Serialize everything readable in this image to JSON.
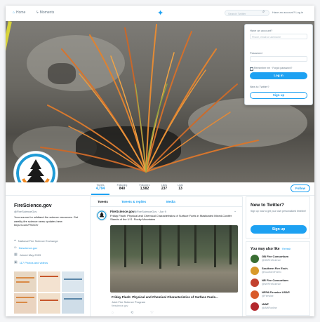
{
  "nav": {
    "home": "Home",
    "moments": "Moments",
    "search_placeholder": "Search Twitter",
    "login_prompt": "Have an account? Log in"
  },
  "login": {
    "prompt": "Have an account?",
    "username_placeholder": "Phone, email or username",
    "password_label": "Password",
    "remember": "Remember me · Forgot password?",
    "login_button": "Log in",
    "new_prompt": "New to Twitter?",
    "signup_button": "Sign up"
  },
  "profile": {
    "name": "FireScience.gov",
    "handle": "@FireScienceGov",
    "bio": "Your source for wildland fire science resources. Get weekly fire science news updates here: tinyurl.com/FSGOV",
    "location": "National Fire Science Exchange",
    "website": "firescience.gov",
    "joined": "Joined May 2009",
    "media_label": "117 Photos and videos"
  },
  "stats": [
    {
      "label": "Tweets",
      "value": "4,794"
    },
    {
      "label": "Following",
      "value": "840"
    },
    {
      "label": "Followers",
      "value": "1,582"
    },
    {
      "label": "Likes",
      "value": "237"
    },
    {
      "label": "Lists",
      "value": "13"
    }
  ],
  "follow_button": "Follow",
  "timeline": {
    "tabs": [
      "Tweets",
      "Tweets & replies",
      "Media"
    ],
    "tweet": {
      "name": "FireScience.gov",
      "handle": "@FireScienceGov · Jun 9",
      "text": "Friday Flash: Physical and Chemical Characteristics of Surface Fuels in Masticated Mixed-Conifer Stands of the U.S. Rocky Mountains",
      "card_title": "Friday Flash: Physical and Chemical Characteristics of Surface Fuels...",
      "card_source": "Joint Fire Science Program",
      "card_url": "firescience.gov"
    }
  },
  "sidebar": {
    "new_title": "New to Twitter?",
    "new_sub": "Sign up now to get your own personalized timeline!",
    "signup": "Sign up",
    "like_title": "You may also like",
    "like_refresh": "· Refresh",
    "suggestions": [
      {
        "name": "GB Fire Consortium",
        "handle": "@GBFireScience",
        "color": "#3a6e33"
      },
      {
        "name": "Southern Fire Exch.",
        "handle": "@SouthernFireEx",
        "color": "#d99a2b"
      },
      {
        "name": "NR Fire Consortium",
        "handle": "@NRFireScience",
        "color": "#c2412f"
      },
      {
        "name": "NFPA Firewise USA®",
        "handle": "@Firewise",
        "color": "#d85a2a"
      },
      {
        "name": "IAWF",
        "handle": "@IAWFonline",
        "color": "#b3282d"
      }
    ]
  },
  "colors": {
    "accent": "#1da1f2",
    "logo_ring": "#1f9bd6",
    "logo_flame": "#f08a24"
  }
}
